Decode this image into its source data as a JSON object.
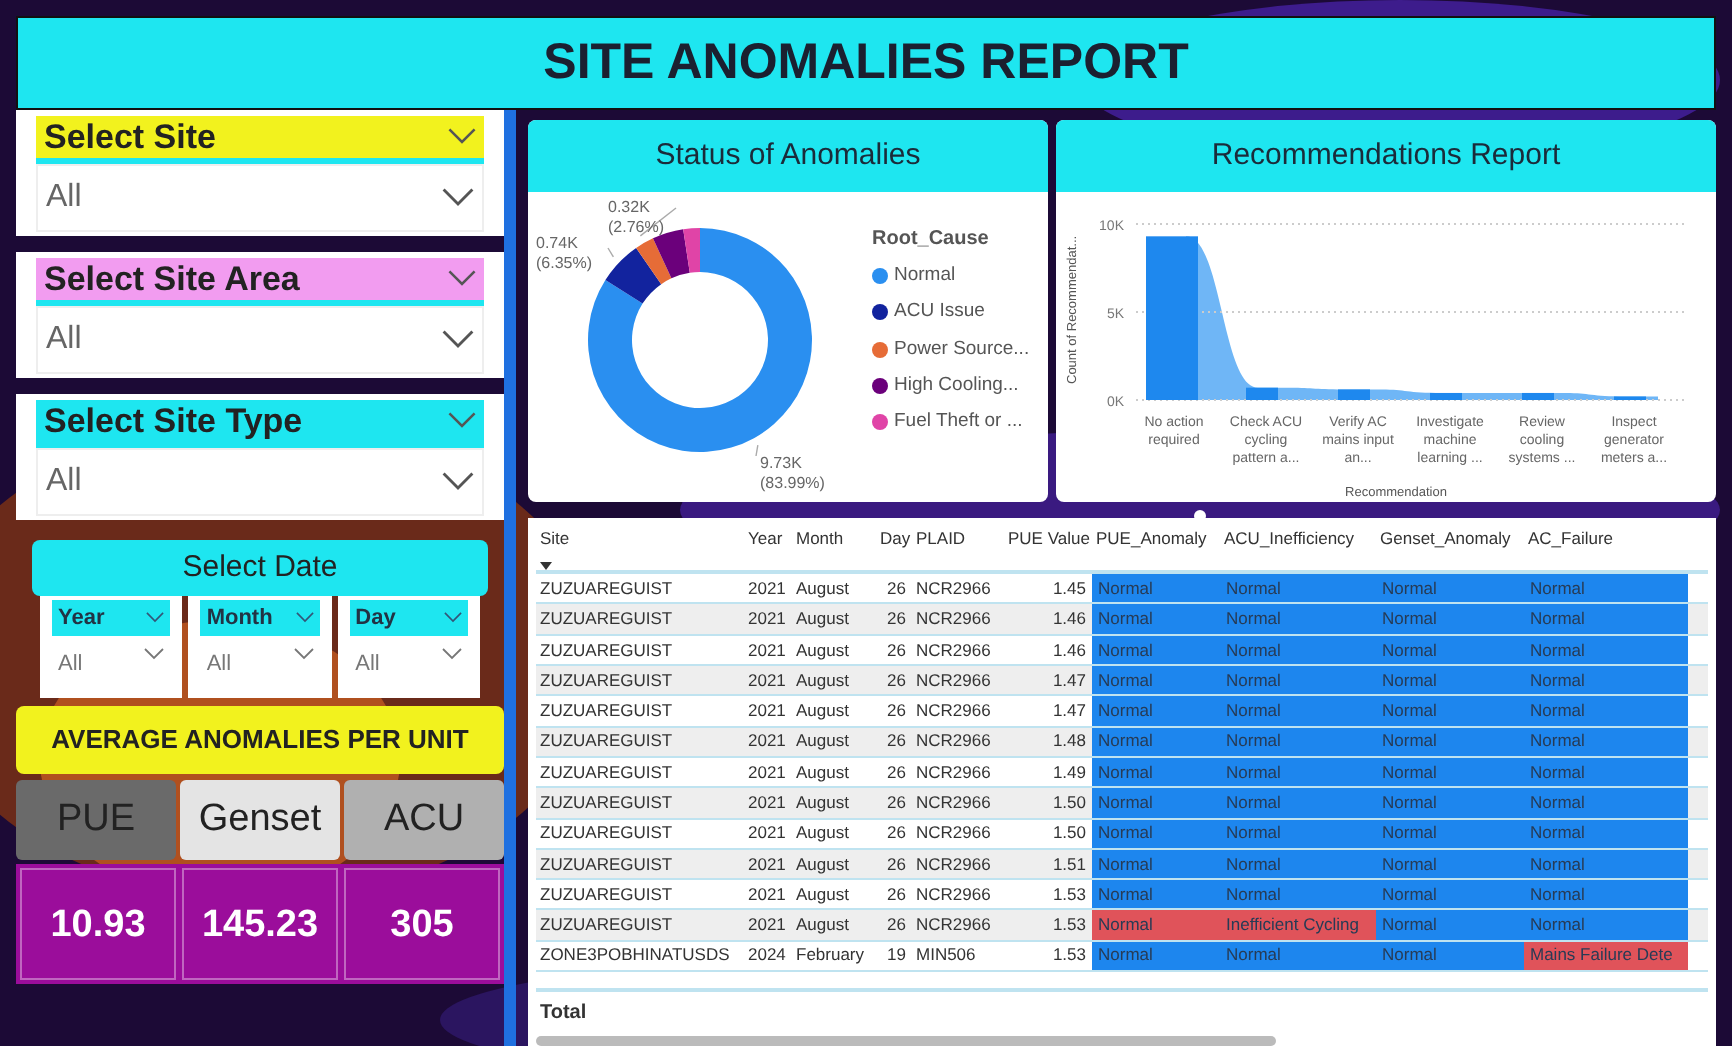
{
  "title": "SITE ANOMALIES REPORT",
  "filters": [
    {
      "label": "Select Site",
      "color": "#f2f21e",
      "value": "All"
    },
    {
      "label": "Select Site Area",
      "color": "#f29cf0",
      "value": "All"
    },
    {
      "label": "Select Site Type",
      "color": "#1ee6f0",
      "value": "All"
    }
  ],
  "date_filter": {
    "label": "Select Date",
    "parts": [
      {
        "label": "Year",
        "value": "All"
      },
      {
        "label": "Month",
        "value": "All"
      },
      {
        "label": "Day",
        "value": "All"
      }
    ]
  },
  "average_banner": "AVERAGE ANOMALIES PER UNIT",
  "units": [
    {
      "label": "PUE",
      "color": "#6a6a6a",
      "value": "10.93"
    },
    {
      "label": "Genset",
      "color": "#e4e4e4",
      "value": "145.23"
    },
    {
      "label": "ACU",
      "color": "#b0b0b0",
      "value": "305"
    }
  ],
  "status_card": {
    "title": "Status of Anomalies",
    "chart_data": {
      "type": "donut",
      "legend_title": "Root_Cause",
      "categories": [
        "Normal",
        "ACU Issue",
        "Power Source...",
        "High Cooling...",
        "Fuel Theft or ..."
      ],
      "series": [
        {
          "values": [
            83.99,
            6.35,
            2.76,
            4.5,
            2.4
          ]
        }
      ],
      "colors": [
        "#2a8ff0",
        "#12239e",
        "#e66c37",
        "#6b007b",
        "#e044a7"
      ],
      "value_labels": [
        [
          "9.73K",
          "(83.99%)"
        ],
        [
          "0.74K",
          "(6.35%)"
        ],
        [
          "0.32K",
          "(2.76%)"
        ],
        null,
        null
      ]
    }
  },
  "recommendations_card": {
    "title": "Recommendations Report",
    "chart_data": {
      "type": "bar",
      "xlabel": "Recommendation",
      "ylabel": "Count of Recommendat...",
      "categories": [
        "No action required",
        "Check ACU cycling pattern a...",
        "Verify AC mains input an...",
        "Investigate machine learning ...",
        "Review cooling systems ...",
        "Inspect generator meters a..."
      ],
      "series": [
        {
          "color": "#1e88ee",
          "values": [
            9300,
            700,
            600,
            400,
            400,
            200
          ]
        }
      ],
      "ylim": [
        0,
        10000
      ],
      "yticks": [
        {
          "value": 0,
          "label": "0K"
        },
        {
          "value": 5000,
          "label": "5K"
        },
        {
          "value": 10000,
          "label": "10K"
        }
      ]
    }
  },
  "table": {
    "columns": [
      "Site",
      "Year",
      "Month",
      "Day",
      "PLAID",
      "PUE Value",
      "PUE_Anomaly",
      "ACU_Inefficiency",
      "Genset_Anomaly",
      "AC_Failure"
    ],
    "rows": [
      {
        "cells": [
          "ZUZUAREGUIST",
          "2021",
          "August",
          "26",
          "NCR2966",
          "1.45"
        ],
        "flags": [
          {
            "text": "Normal",
            "alert": false
          },
          {
            "text": "Normal",
            "alert": false
          },
          {
            "text": "Normal",
            "alert": false
          },
          {
            "text": "Normal",
            "alert": false
          }
        ]
      },
      {
        "cells": [
          "ZUZUAREGUIST",
          "2021",
          "August",
          "26",
          "NCR2966",
          "1.46"
        ],
        "flags": [
          {
            "text": "Normal",
            "alert": false
          },
          {
            "text": "Normal",
            "alert": false
          },
          {
            "text": "Normal",
            "alert": false
          },
          {
            "text": "Normal",
            "alert": false
          }
        ]
      },
      {
        "cells": [
          "ZUZUAREGUIST",
          "2021",
          "August",
          "26",
          "NCR2966",
          "1.46"
        ],
        "flags": [
          {
            "text": "Normal",
            "alert": false
          },
          {
            "text": "Normal",
            "alert": false
          },
          {
            "text": "Normal",
            "alert": false
          },
          {
            "text": "Normal",
            "alert": false
          }
        ]
      },
      {
        "cells": [
          "ZUZUAREGUIST",
          "2021",
          "August",
          "26",
          "NCR2966",
          "1.47"
        ],
        "flags": [
          {
            "text": "Normal",
            "alert": false
          },
          {
            "text": "Normal",
            "alert": false
          },
          {
            "text": "Normal",
            "alert": false
          },
          {
            "text": "Normal",
            "alert": false
          }
        ]
      },
      {
        "cells": [
          "ZUZUAREGUIST",
          "2021",
          "August",
          "26",
          "NCR2966",
          "1.47"
        ],
        "flags": [
          {
            "text": "Normal",
            "alert": false
          },
          {
            "text": "Normal",
            "alert": false
          },
          {
            "text": "Normal",
            "alert": false
          },
          {
            "text": "Normal",
            "alert": false
          }
        ]
      },
      {
        "cells": [
          "ZUZUAREGUIST",
          "2021",
          "August",
          "26",
          "NCR2966",
          "1.48"
        ],
        "flags": [
          {
            "text": "Normal",
            "alert": false
          },
          {
            "text": "Normal",
            "alert": false
          },
          {
            "text": "Normal",
            "alert": false
          },
          {
            "text": "Normal",
            "alert": false
          }
        ]
      },
      {
        "cells": [
          "ZUZUAREGUIST",
          "2021",
          "August",
          "26",
          "NCR2966",
          "1.49"
        ],
        "flags": [
          {
            "text": "Normal",
            "alert": false
          },
          {
            "text": "Normal",
            "alert": false
          },
          {
            "text": "Normal",
            "alert": false
          },
          {
            "text": "Normal",
            "alert": false
          }
        ]
      },
      {
        "cells": [
          "ZUZUAREGUIST",
          "2021",
          "August",
          "26",
          "NCR2966",
          "1.50"
        ],
        "flags": [
          {
            "text": "Normal",
            "alert": false
          },
          {
            "text": "Normal",
            "alert": false
          },
          {
            "text": "Normal",
            "alert": false
          },
          {
            "text": "Normal",
            "alert": false
          }
        ]
      },
      {
        "cells": [
          "ZUZUAREGUIST",
          "2021",
          "August",
          "26",
          "NCR2966",
          "1.50"
        ],
        "flags": [
          {
            "text": "Normal",
            "alert": false
          },
          {
            "text": "Normal",
            "alert": false
          },
          {
            "text": "Normal",
            "alert": false
          },
          {
            "text": "Normal",
            "alert": false
          }
        ]
      },
      {
        "cells": [
          "ZUZUAREGUIST",
          "2021",
          "August",
          "26",
          "NCR2966",
          "1.51"
        ],
        "flags": [
          {
            "text": "Normal",
            "alert": false
          },
          {
            "text": "Normal",
            "alert": false
          },
          {
            "text": "Normal",
            "alert": false
          },
          {
            "text": "Normal",
            "alert": false
          }
        ]
      },
      {
        "cells": [
          "ZUZUAREGUIST",
          "2021",
          "August",
          "26",
          "NCR2966",
          "1.53"
        ],
        "flags": [
          {
            "text": "Normal",
            "alert": false
          },
          {
            "text": "Normal",
            "alert": false
          },
          {
            "text": "Normal",
            "alert": false
          },
          {
            "text": "Normal",
            "alert": false
          }
        ]
      },
      {
        "cells": [
          "ZUZUAREGUIST",
          "2021",
          "August",
          "26",
          "NCR2966",
          "1.53"
        ],
        "flags": [
          {
            "text": "Normal",
            "alert": true
          },
          {
            "text": "Inefficient Cycling",
            "alert": true
          },
          {
            "text": "Normal",
            "alert": false
          },
          {
            "text": "Normal",
            "alert": false
          }
        ]
      },
      {
        "cells": [
          "ZONE3POBHINATUSDS",
          "2024",
          "February",
          "19",
          "MIN506",
          "1.53"
        ],
        "flags": [
          {
            "text": "Normal",
            "alert": false
          },
          {
            "text": "Normal",
            "alert": false
          },
          {
            "text": "Normal",
            "alert": false
          },
          {
            "text": "Mains Failure Dete",
            "alert": true
          }
        ]
      }
    ],
    "total_label": "Total"
  }
}
